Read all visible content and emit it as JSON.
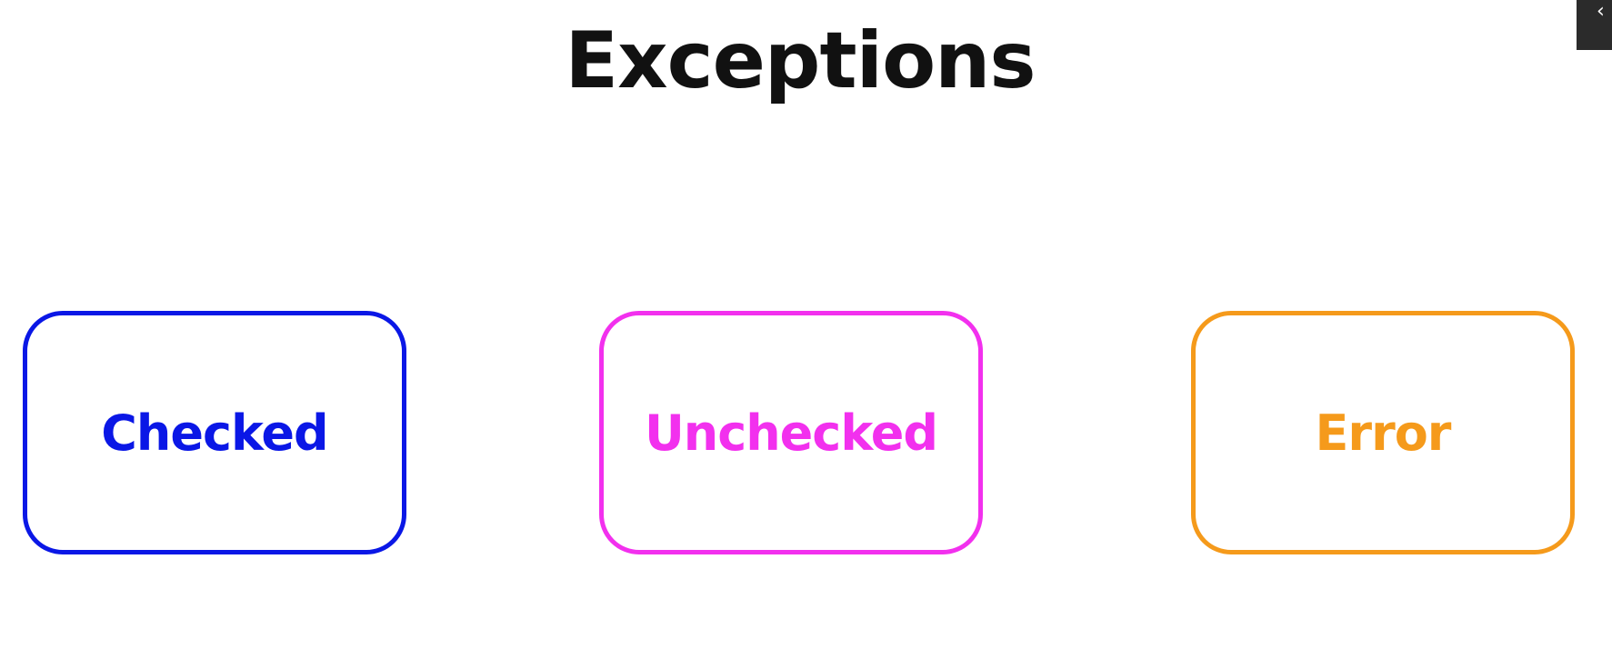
{
  "title": "Exceptions",
  "categories": [
    {
      "label": "Checked",
      "color": "#0a17e6"
    },
    {
      "label": "Unchecked",
      "color": "#f230ee"
    },
    {
      "label": "Error",
      "color": "#f59a1b"
    }
  ],
  "corner": {
    "glyph": "‹"
  }
}
